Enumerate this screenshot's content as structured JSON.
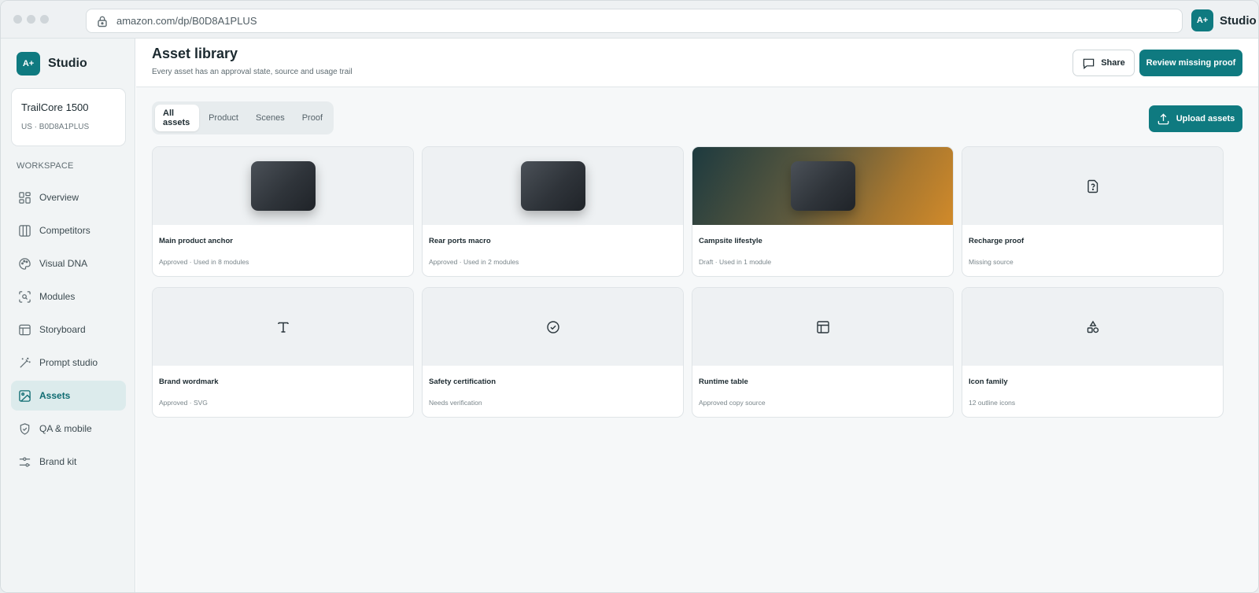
{
  "browser": {
    "url": "amazon.com/dp/B0D8A1PLUS",
    "brand_logo": "A+",
    "brand_name": "Studio"
  },
  "sidebar": {
    "logo": "A+",
    "brand_name": "Studio",
    "product": {
      "name": "TrailCore 1500",
      "sku": "US · B0D8A1PLUS"
    },
    "section_label": "WORKSPACE",
    "items": [
      {
        "label": "Overview",
        "icon": "grid-icon"
      },
      {
        "label": "Competitors",
        "icon": "columns-icon"
      },
      {
        "label": "Visual DNA",
        "icon": "palette-icon"
      },
      {
        "label": "Modules",
        "icon": "scan-search-icon"
      },
      {
        "label": "Storyboard",
        "icon": "layout-icon"
      },
      {
        "label": "Prompt studio",
        "icon": "magic-wand-icon"
      },
      {
        "label": "Assets",
        "icon": "image-icon",
        "active": true
      },
      {
        "label": "QA & mobile",
        "icon": "shield-check-icon"
      },
      {
        "label": "Brand kit",
        "icon": "sliders-icon"
      }
    ]
  },
  "header": {
    "title": "Asset library",
    "subtitle": "Every asset has an approval state, source and usage trail",
    "share_label": "Share",
    "review_label": "Review missing proof"
  },
  "tabs": [
    {
      "label": "All assets",
      "active": true
    },
    {
      "label": "Product"
    },
    {
      "label": "Scenes"
    },
    {
      "label": "Proof"
    }
  ],
  "upload_label": "Upload assets",
  "assets": [
    {
      "title": "Main product anchor",
      "meta": "Approved · Used in 8 modules",
      "thumb": "device"
    },
    {
      "title": "Rear ports macro",
      "meta": "Approved · Used in 2 modules",
      "thumb": "device"
    },
    {
      "title": "Campsite lifestyle",
      "meta": "Draft · Used in 1 module",
      "thumb": "lifestyle"
    },
    {
      "title": "Recharge proof",
      "meta": "Missing source",
      "thumb": "file-question-icon"
    },
    {
      "title": "Brand wordmark",
      "meta": "Approved · SVG",
      "thumb": "type-icon"
    },
    {
      "title": "Safety certification",
      "meta": "Needs verification",
      "thumb": "circle-check-icon"
    },
    {
      "title": "Runtime table",
      "meta": "Approved copy source",
      "thumb": "table-icon"
    },
    {
      "title": "Icon family",
      "meta": "12 outline icons",
      "thumb": "shapes-icon"
    }
  ],
  "colors": {
    "accent": "#0f7a80",
    "active_nav_bg": "#dcebec",
    "page_bg": "#f6f8f9"
  }
}
